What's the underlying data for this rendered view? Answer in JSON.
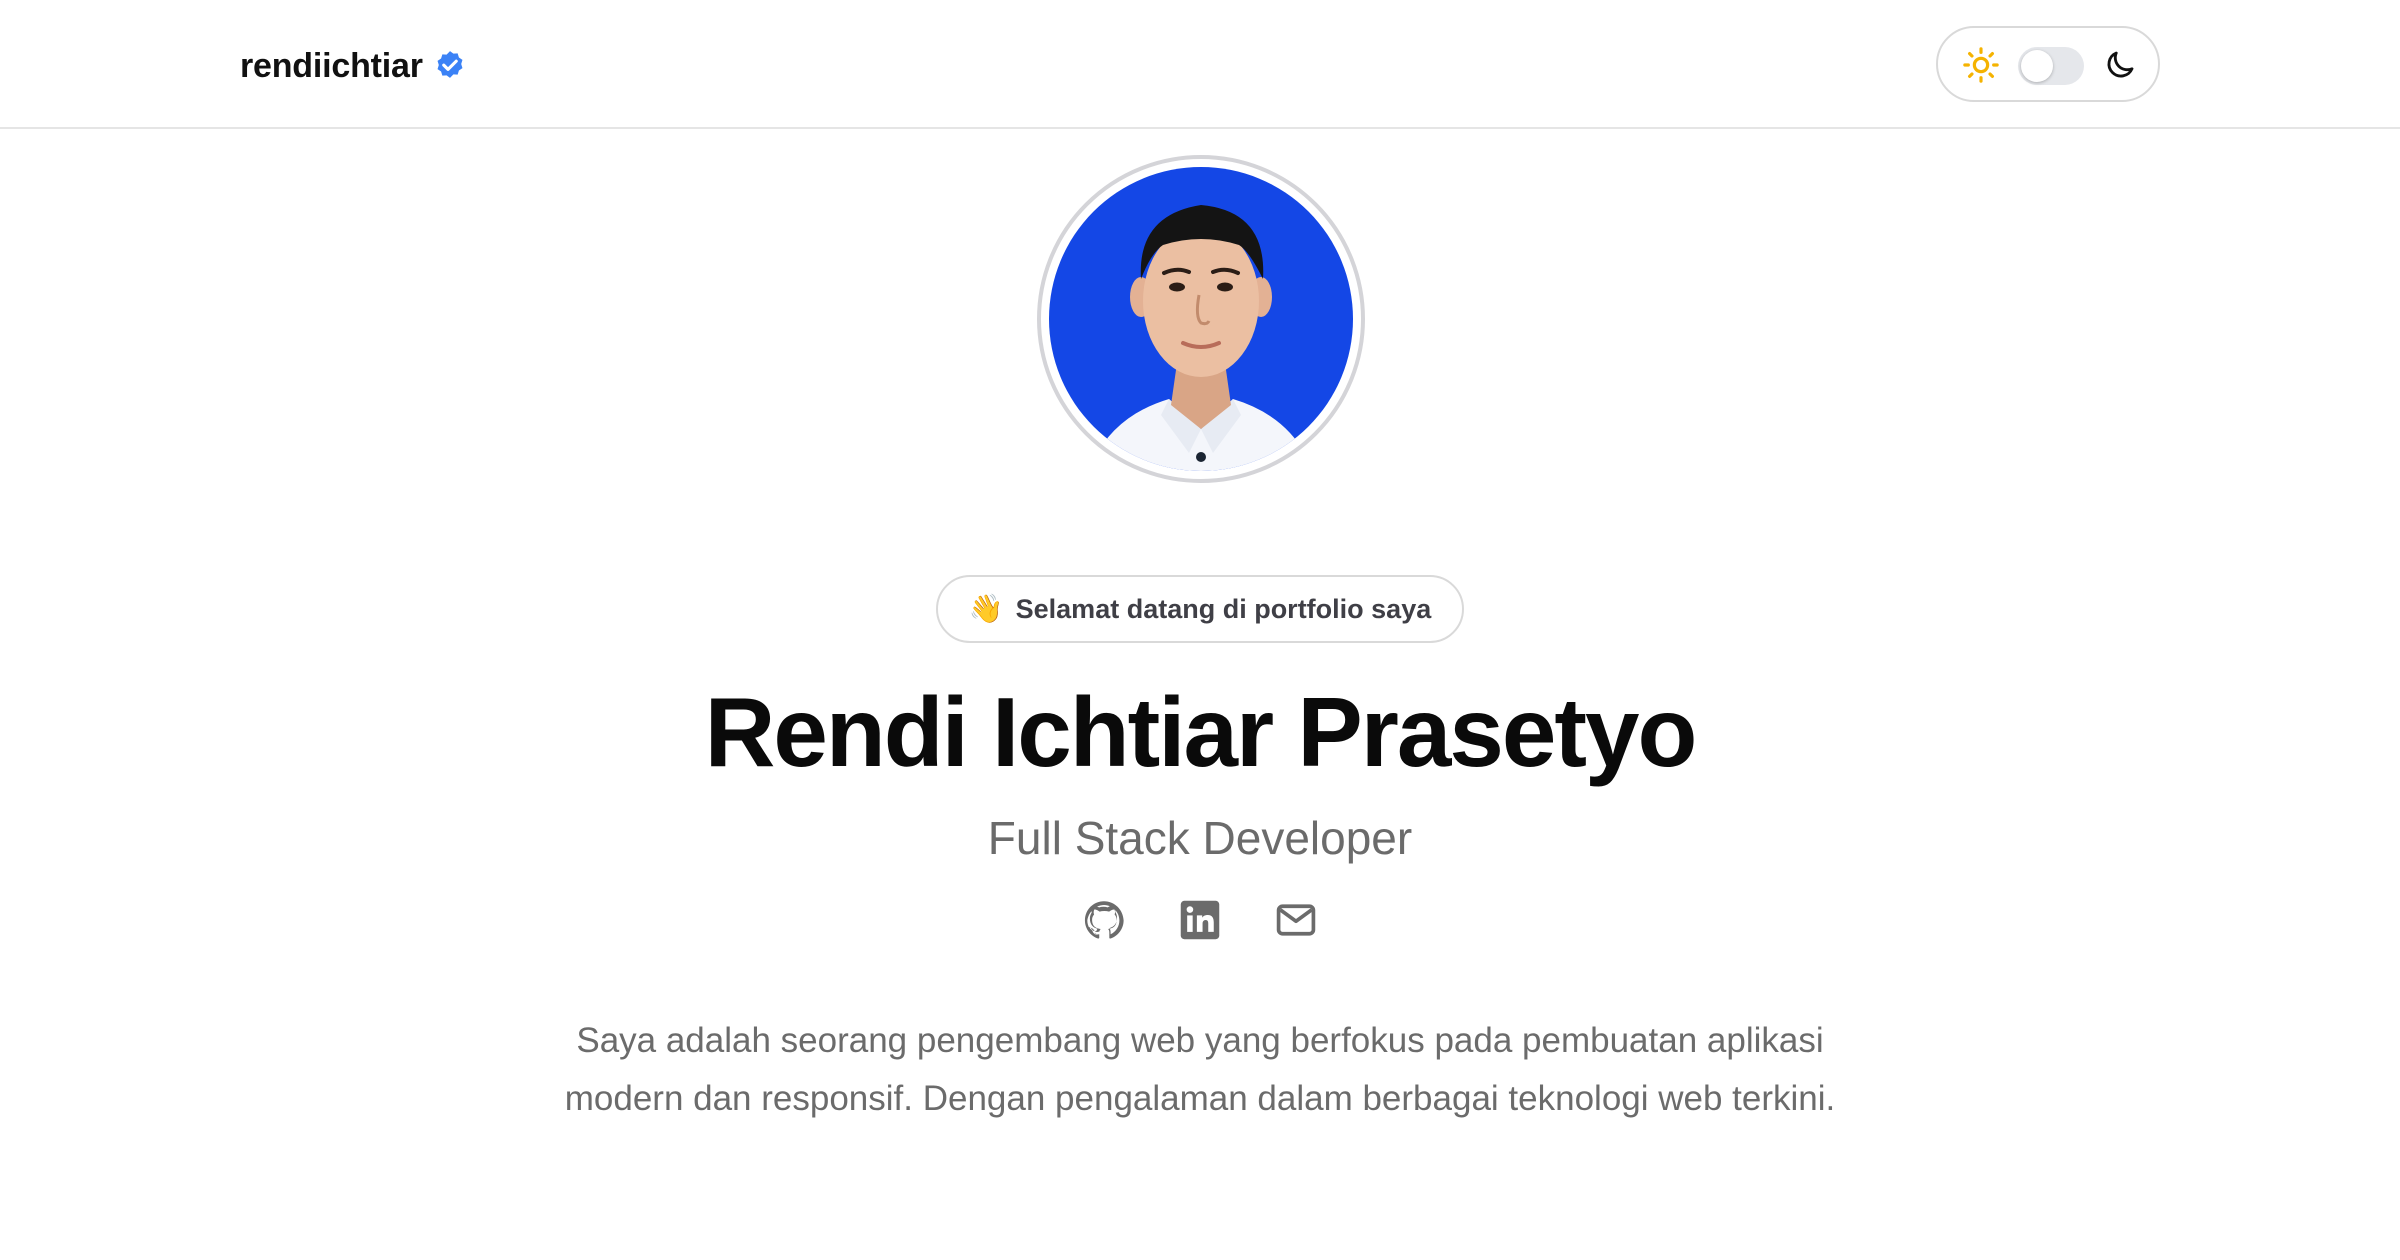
{
  "header": {
    "brand_name": "rendiichtiar",
    "verified_icon": "verified-badge-icon",
    "theme_toggle": {
      "light_icon": "sun-icon",
      "dark_icon": "moon-icon",
      "state": "light"
    }
  },
  "hero": {
    "avatar_icon": "profile-photo",
    "welcome_emoji": "👋",
    "welcome_text": "Selamat datang di portfolio saya",
    "name": "Rendi Ichtiar Prasetyo",
    "role": "Full Stack Developer",
    "social_links": [
      {
        "icon": "github-icon"
      },
      {
        "icon": "linkedin-icon"
      },
      {
        "icon": "mail-icon"
      }
    ],
    "bio_lines": [
      "Saya adalah seorang pengembang web yang berfokus pada pembuatan aplikasi",
      "modern dan responsif. Dengan pengalaman dalam berbagai teknologi web terkini."
    ]
  },
  "colors": {
    "verified_blue": "#3b82f6",
    "sun_yellow": "#f5b301",
    "avatar_background": "#1447e6",
    "heading": "#0a0a0a",
    "muted_text": "#6b6b6b",
    "border": "#d9d9d9"
  }
}
